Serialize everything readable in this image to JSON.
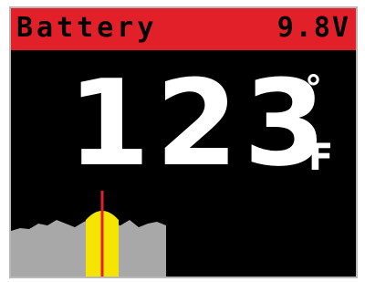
{
  "status_bar": {
    "title": "Battery",
    "voltage": "9.8V",
    "background_color": "#e2202a"
  },
  "reading": {
    "value": "123",
    "degree_symbol": "°",
    "unit": "F",
    "color": "#ffffff"
  },
  "spectrum_graph": {
    "fill_color": "#a8a8a8",
    "highlight_color": "#f5e400",
    "marker_color": "#e2202a",
    "profile_levels": [
      0.52,
      0.55,
      0.54,
      0.6,
      0.58,
      0.64,
      0.6,
      0.56,
      0.62,
      0.66,
      0.63,
      0.6,
      0.58,
      0.64,
      0.56,
      0.6,
      0.62,
      0.58
    ],
    "peak_level": 0.78,
    "marker_level": 0.96
  }
}
